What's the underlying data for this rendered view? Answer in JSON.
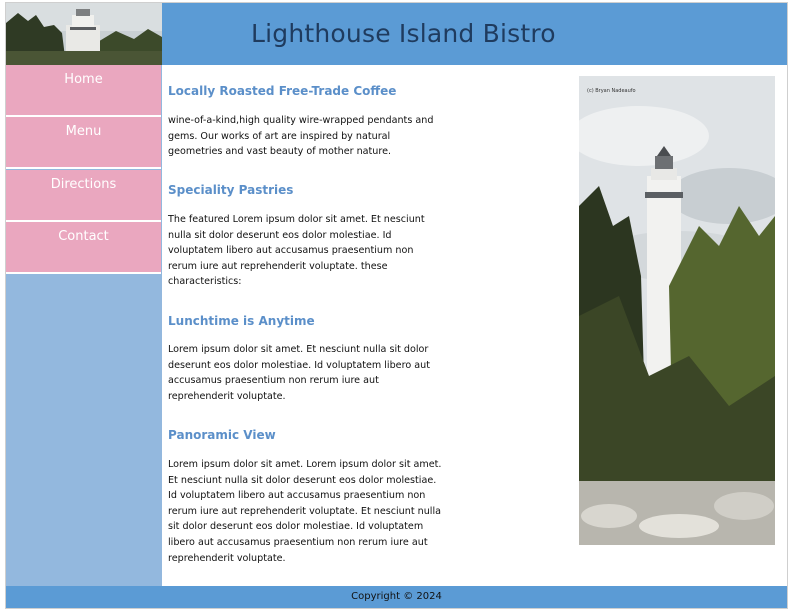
{
  "header": {
    "title": "Lighthouse Island Bistro"
  },
  "nav": {
    "items": [
      {
        "label": "Home"
      },
      {
        "label": "Menu"
      },
      {
        "label": "Directions"
      },
      {
        "label": "Contact"
      }
    ]
  },
  "main": {
    "sections": [
      {
        "title": "Locally Roasted Free-Trade Coffee",
        "body": "wine-of-a-kind,high quality wire-wrapped pendants and gems. Our works of art are inspired by natural geometries and vast beauty of mother nature."
      },
      {
        "title": "Speciality Pastries",
        "body": "The featured Lorem ipsum dolor sit amet. Et nesciunt nulla sit dolor deserunt eos dolor molestiae. Id voluptatem libero aut accusamus praesentium non rerum iure aut reprehenderit voluptate. these characteristics:"
      },
      {
        "title": "Lunchtime is Anytime",
        "body": "Lorem ipsum dolor sit amet. Et nesciunt nulla sit dolor deserunt eos dolor molestiae. Id voluptatem libero aut accusamus praesentium non rerum iure aut reprehenderit voluptate."
      },
      {
        "title": "Panoramic View",
        "body": "Lorem ipsum dolor sit amet. Lorem ipsum dolor sit amet. Et nesciunt nulla sit dolor deserunt eos dolor molestiae. Id voluptatem libero aut accusamus praesentium non rerum iure aut reprehenderit voluptate. Et nesciunt nulla sit dolor deserunt eos dolor molestiae. Id voluptatem libero aut accusamus praesentium non rerum iure aut reprehenderit voluptate."
      }
    ]
  },
  "photo": {
    "caption": "(c) Bryan Nadeaufo"
  },
  "footer": {
    "copyright": "Copyright © 2024"
  },
  "colors": {
    "header_bg": "#5b9bd5",
    "title_text": "#1f3b5e",
    "nav_bg": "#eaa7bf",
    "sidebar_bg": "#93b8de",
    "section_title": "#5b8fc9"
  }
}
